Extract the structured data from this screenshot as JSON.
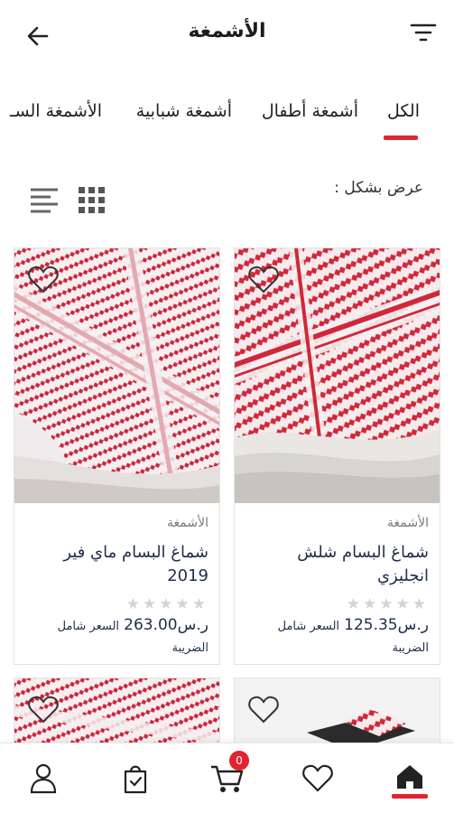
{
  "header": {
    "title": "الأشمغة"
  },
  "tabs": [
    {
      "label": "الكل",
      "active": true
    },
    {
      "label": "أشمغة أطفال",
      "active": false
    },
    {
      "label": "أشمغة شبابية",
      "active": false
    },
    {
      "label": "الأشمغة السـ",
      "active": false
    }
  ],
  "view": {
    "label": "عرض بشكل :"
  },
  "products": [
    {
      "category": "الأشمغة",
      "title": "شماغ البسام شلش انجليزي",
      "rating": 0,
      "price": "125.35",
      "currency": "ر.س",
      "price_note": "السعر شامل الضريبة"
    },
    {
      "category": "الأشمغة",
      "title": "شماغ البسام ماي فير 2019",
      "rating": 0,
      "price": "263.00",
      "currency": "ر.س",
      "price_note": "السعر شامل الضريبة"
    }
  ],
  "cart": {
    "count": "0"
  },
  "colors": {
    "accent": "#e1242f",
    "title_text": "#1f2d4d",
    "shemagh_red": "#d0283a"
  },
  "icons": {
    "back": "arrow-left-icon",
    "filter": "filter-icon",
    "list": "list-view-icon",
    "grid": "grid-view-icon",
    "favorite": "heart-icon",
    "home": "home-icon",
    "cart": "cart-icon",
    "orders": "shopping-bag-icon",
    "account": "user-icon"
  }
}
